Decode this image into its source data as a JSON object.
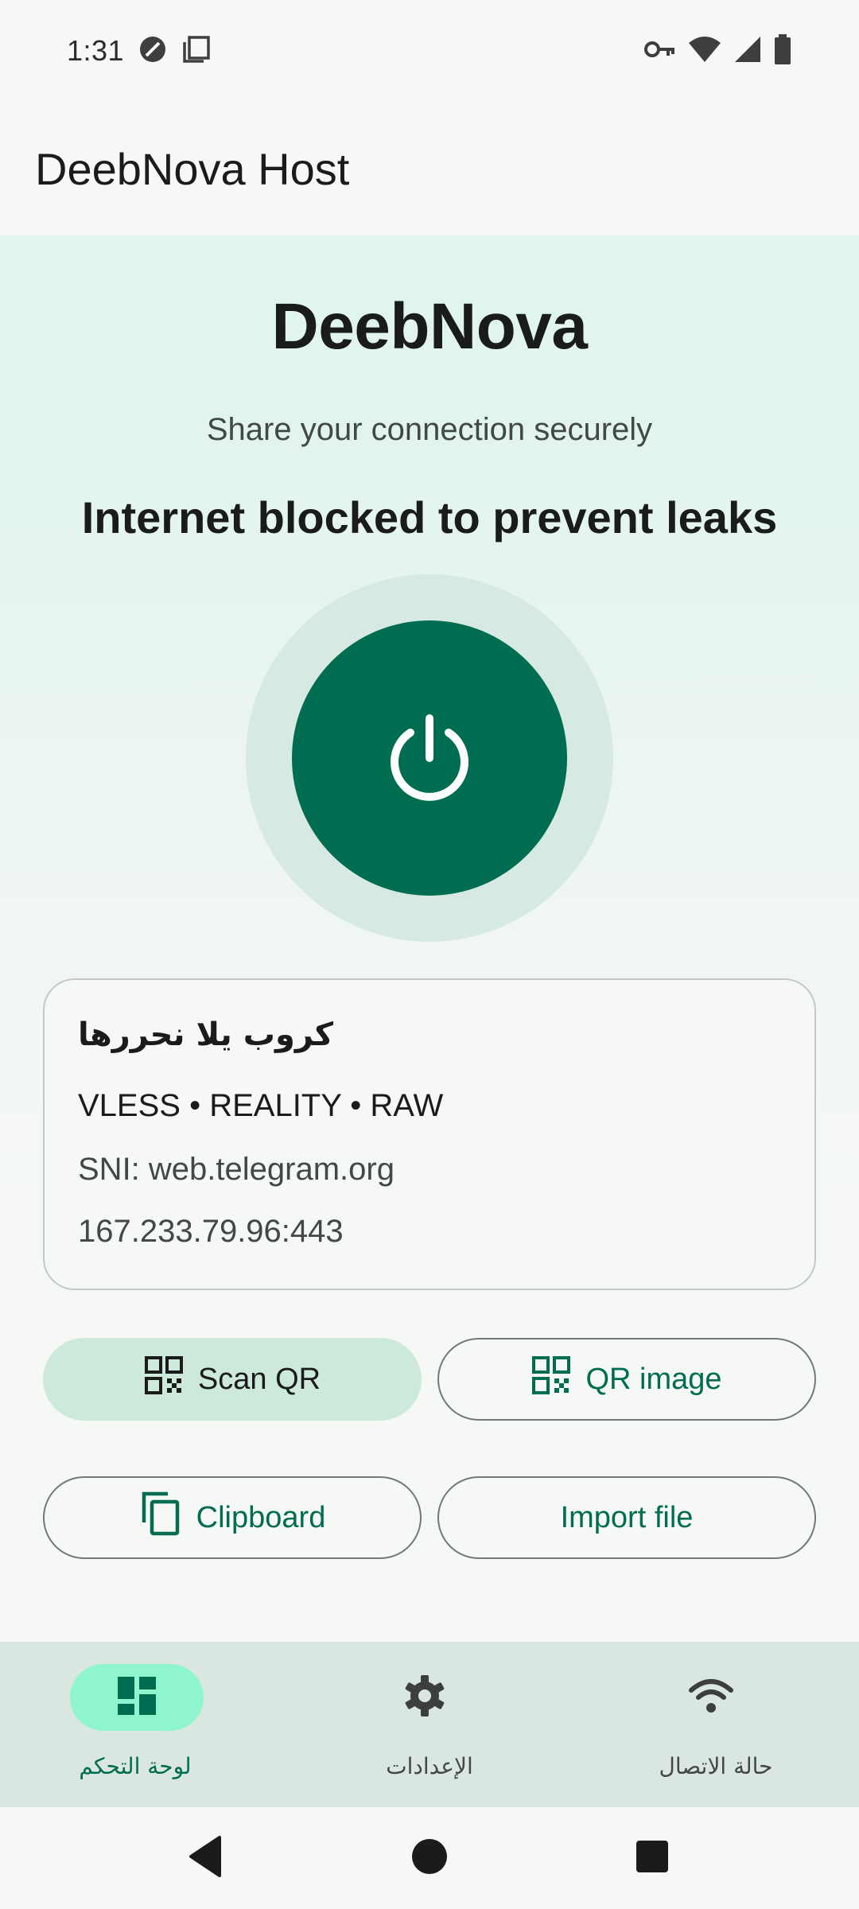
{
  "status_bar": {
    "time": "1:31",
    "left_icons": [
      "do-not-disturb-icon",
      "copy-notification-icon"
    ],
    "right_icons": [
      "vpn-key-icon",
      "wifi-icon",
      "cellular-signal-icon",
      "battery-icon"
    ]
  },
  "app_bar": {
    "title": "DeebNova Host"
  },
  "main": {
    "brand": "DeebNova",
    "tagline": "Share your connection securely",
    "status_message": "Internet blocked to prevent leaks",
    "power_button_icon": "power-icon"
  },
  "config": {
    "name": "كروب يلا نحررها",
    "protocol": "VLESS • REALITY • RAW",
    "sni": "SNI: web.telegram.org",
    "address": "167.233.79.96:443"
  },
  "actions": {
    "scan_qr": "Scan QR",
    "qr_image": "QR image",
    "clipboard": "Clipboard",
    "import_file": "Import file"
  },
  "bottom_nav": {
    "items": [
      {
        "label": "لوحة التحكم",
        "icon": "dashboard-icon",
        "active": true
      },
      {
        "label": "الإعدادات",
        "icon": "settings-icon",
        "active": false
      },
      {
        "label": "حالة الاتصال",
        "icon": "wifi-icon",
        "active": false
      }
    ]
  },
  "colors": {
    "primary": "#006c50",
    "active_indicator": "#8ef5cf",
    "tonal_button": "#cde9dc",
    "nav_background": "#dae7e0"
  }
}
